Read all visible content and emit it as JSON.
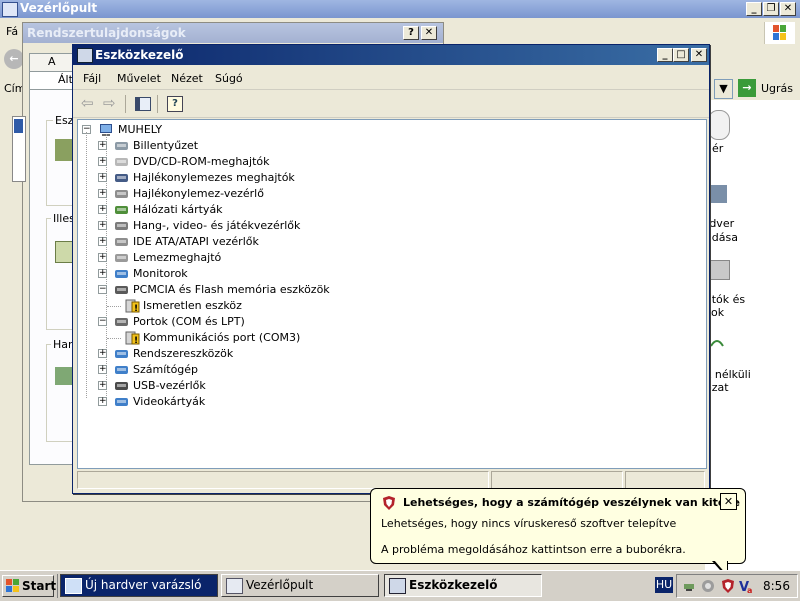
{
  "control_panel": {
    "title": "Vezérlőpult",
    "menu_fragment": "Fá",
    "address_fragment": "Cím",
    "go_label": "Ugrás",
    "right_items": [
      "gér",
      "rdver",
      "adása",
      "atók és",
      "kok",
      "k nélküli",
      "ózat"
    ]
  },
  "system_properties": {
    "title": "Rendszertulajdonságok",
    "tab_fragment_1": "A ren",
    "tab_fragment_2": "Ált",
    "group_fragment_1": "Esz",
    "group_fragment_2": "Illes",
    "group_fragment_3": "Har"
  },
  "device_manager": {
    "title": "Eszközkezelő",
    "menu": [
      "Fájl",
      "Művelet",
      "Nézet",
      "Súgó"
    ],
    "root": "MUHELY",
    "tree": [
      {
        "label": "Billentyűzet",
        "expanded": false,
        "level": 1,
        "icon": "keyboard-icon"
      },
      {
        "label": "DVD/CD-ROM-meghajtók",
        "expanded": false,
        "level": 1,
        "icon": "cdrom-icon"
      },
      {
        "label": "Hajlékonylemezes meghajtók",
        "expanded": false,
        "level": 1,
        "icon": "floppy-drive-icon"
      },
      {
        "label": "Hajlékonylemez-vezérlő",
        "expanded": false,
        "level": 1,
        "icon": "floppy-controller-icon"
      },
      {
        "label": "Hálózati kártyák",
        "expanded": false,
        "level": 1,
        "icon": "network-card-icon"
      },
      {
        "label": "Hang-, video- és játékvezérlők",
        "expanded": false,
        "level": 1,
        "icon": "sound-icon"
      },
      {
        "label": "IDE ATA/ATAPI vezérlők",
        "expanded": false,
        "level": 1,
        "icon": "ide-controller-icon"
      },
      {
        "label": "Lemezmeghajtó",
        "expanded": false,
        "level": 1,
        "icon": "disk-drive-icon"
      },
      {
        "label": "Monitorok",
        "expanded": false,
        "level": 1,
        "icon": "monitor-icon"
      },
      {
        "label": "PCMCIA és Flash memória eszközök",
        "expanded": true,
        "level": 1,
        "icon": "pcmcia-icon"
      },
      {
        "label": "Ismeretlen eszköz",
        "expanded": null,
        "level": 2,
        "icon": "unknown-device-warning-icon"
      },
      {
        "label": "Portok (COM és LPT)",
        "expanded": true,
        "level": 1,
        "icon": "port-icon"
      },
      {
        "label": "Kommunikációs port (COM3)",
        "expanded": null,
        "level": 2,
        "icon": "com-port-warning-icon"
      },
      {
        "label": "Rendszereszközök",
        "expanded": false,
        "level": 1,
        "icon": "system-devices-icon"
      },
      {
        "label": "Számítógép",
        "expanded": false,
        "level": 1,
        "icon": "computer-icon"
      },
      {
        "label": "USB-vezérlők",
        "expanded": false,
        "level": 1,
        "icon": "usb-icon"
      },
      {
        "label": "Videokártyák",
        "expanded": false,
        "level": 1,
        "icon": "video-card-icon"
      }
    ]
  },
  "balloon": {
    "title": "Lehetséges, hogy a számítógép veszélynek van kitéve",
    "line1": "Lehetséges, hogy nincs víruskereső szoftver telepítve",
    "line2": "A probléma megoldásához kattintson erre a buborékra."
  },
  "taskbar": {
    "start_label": "Start",
    "tasks": [
      "Új hardver varázsló",
      "Vezérlőpult",
      "Eszközkezelő"
    ],
    "language": "HU",
    "clock": "8:56"
  },
  "colors": {
    "title_active": "#0a246a",
    "title_inactive": "#a3b1d1",
    "balloon_bg": "#ffffe1"
  }
}
